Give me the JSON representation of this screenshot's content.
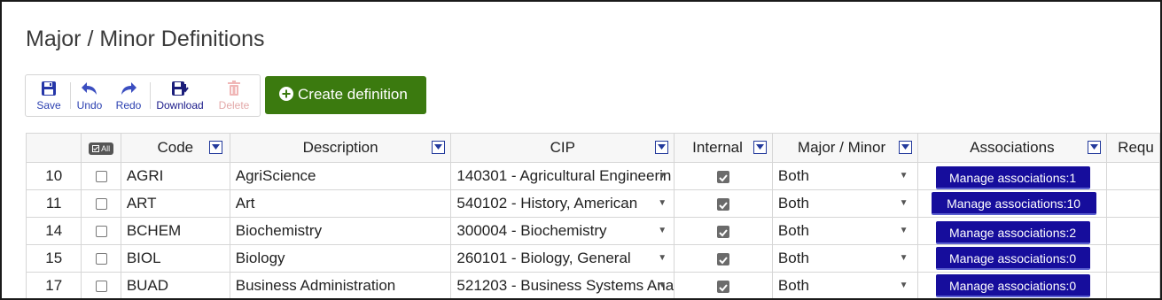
{
  "page": {
    "title": "Major / Minor Definitions"
  },
  "toolbar": {
    "save": "Save",
    "undo": "Undo",
    "redo": "Redo",
    "download": "Download",
    "delete": "Delete"
  },
  "create_button": "Create definition",
  "table": {
    "headers": {
      "select_all": "All",
      "code": "Code",
      "description": "Description",
      "cip": "CIP",
      "internal": "Internal",
      "major_minor": "Major / Minor",
      "associations": "Associations",
      "req": "Requ"
    },
    "rows": [
      {
        "id": "10",
        "code": "AGRI",
        "description": "AgriScience",
        "cip": "140301 - Agricultural Engineerin",
        "internal": true,
        "major_minor": "Both",
        "associations": "Manage associations:1"
      },
      {
        "id": "11",
        "code": "ART",
        "description": "Art",
        "cip": "540102 - History, American",
        "internal": true,
        "major_minor": "Both",
        "associations": "Manage associations:10"
      },
      {
        "id": "14",
        "code": "BCHEM",
        "description": "Biochemistry",
        "cip": "300004 - Biochemistry",
        "internal": true,
        "major_minor": "Both",
        "associations": "Manage associations:2"
      },
      {
        "id": "15",
        "code": "BIOL",
        "description": "Biology",
        "cip": "260101 - Biology, General",
        "internal": true,
        "major_minor": "Both",
        "associations": "Manage associations:0"
      },
      {
        "id": "17",
        "code": "BUAD",
        "description": "Business Administration",
        "cip": "521203 - Business Systems Ana",
        "internal": true,
        "major_minor": "Both",
        "associations": "Manage associations:0"
      }
    ]
  }
}
